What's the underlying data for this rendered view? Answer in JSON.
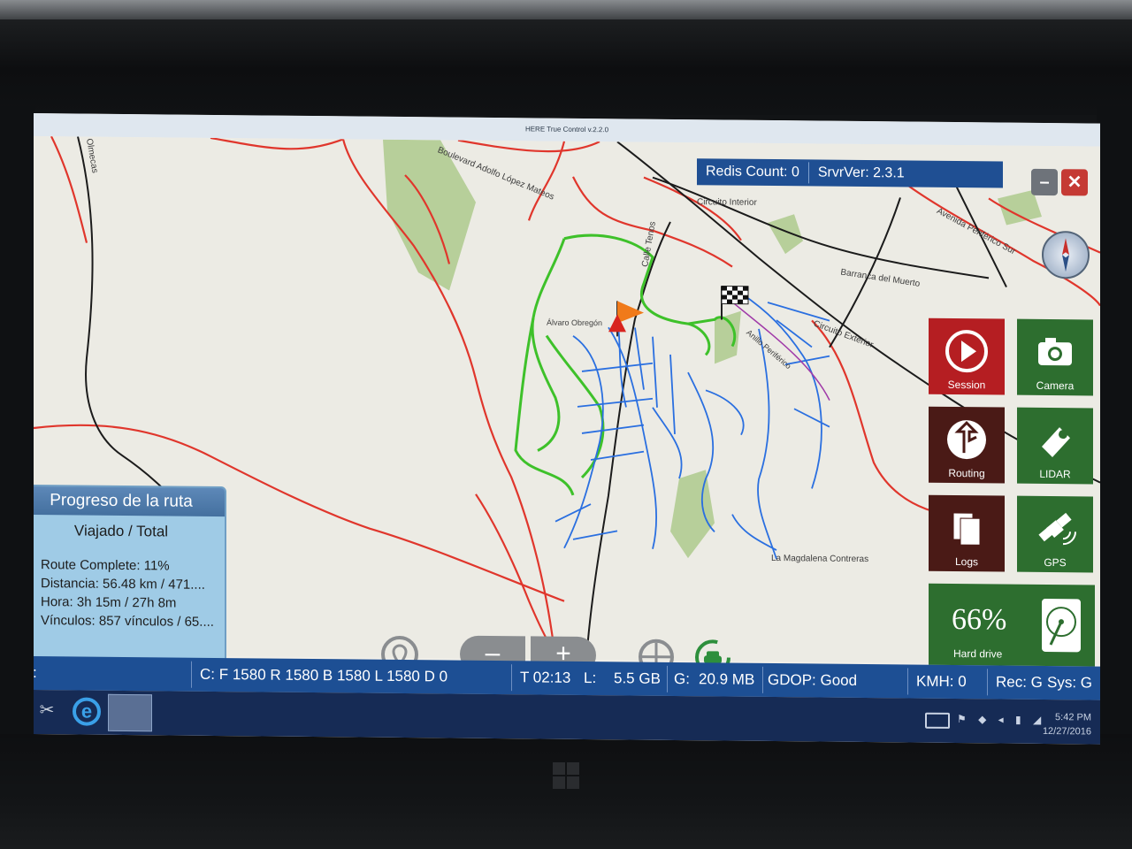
{
  "window": {
    "title": "HERE True Control v.2.2.0"
  },
  "server": {
    "redis_count": "Redis Count: 0",
    "server_version": "SrvrVer: 2.3.1"
  },
  "window_buttons": {
    "minimize": "–",
    "close": "✕"
  },
  "map": {
    "labels": {
      "olmecas": "Olmecas",
      "boulevard": "Boulevard Adolfo López Mateos",
      "circuito_interior": "Circuito Interior",
      "calle_tenos": "Calle Tenos",
      "periferico_sur": "Avenida Periférico Sur",
      "barranca": "Barranca del Muerto",
      "circuito_exterior": "Circuito Exterior",
      "alvaro_obregon": "Álvaro Obregón",
      "anillo_periferico": "Anillo Periférico",
      "magdalena": "La Magdalena Contreras"
    }
  },
  "tiles": {
    "session": "Session",
    "camera": "Camera",
    "routing": "Routing",
    "lidar": "LIDAR",
    "logs": "Logs",
    "gps": "GPS",
    "hard_drive_pct": "66%",
    "hard_drive_label": "Hard drive"
  },
  "progress": {
    "title": "Progreso de la ruta",
    "subtitle": "Viajado / Total",
    "route_complete": "Route Complete: 11%",
    "distancia": "Distancia: 56.48 km / 471....",
    "hora": "Hora: 3h 15m / 27h 8m",
    "vinculos": "Vínculos: 857 vínculos / 65...."
  },
  "zoom": {
    "out": "–",
    "in": "+"
  },
  "status": {
    "id": "ID:",
    "cameras": "C: F 1580 R 1580 B 1580 L 1580 D 0",
    "time": "T 02:13",
    "lidar": "L:",
    "lidar_size": "5.5 GB",
    "gps": "G:",
    "gps_size": "20.9 MB",
    "gdop": "GDOP: Good",
    "kmh": "KMH: 0",
    "rec": "Rec: G",
    "sys": "Sys: G"
  },
  "taskbar": {
    "time": "5:42 PM",
    "date": "12/27/2016"
  },
  "colors": {
    "accent_blue": "#1d4f94",
    "tile_red": "#b51e22",
    "tile_green": "#2d6e2f",
    "tile_dark": "#4a1a16",
    "track_green": "#3ec12a",
    "track_blue": "#2a6fe0",
    "road_red": "#e0362c"
  },
  "icons": {
    "session": "play-icon",
    "camera": "camera-icon",
    "routing": "routing-arrow-icon",
    "lidar": "lidar-icon",
    "logs": "documents-icon",
    "gps": "satellite-icon",
    "hard_drive": "hard-drive-icon",
    "location": "location-pin-icon",
    "center": "crosshair-icon",
    "car": "car-follow-icon",
    "compass": "compass-icon",
    "finish": "checkered-flag-icon",
    "start": "orange-flag-icon"
  }
}
